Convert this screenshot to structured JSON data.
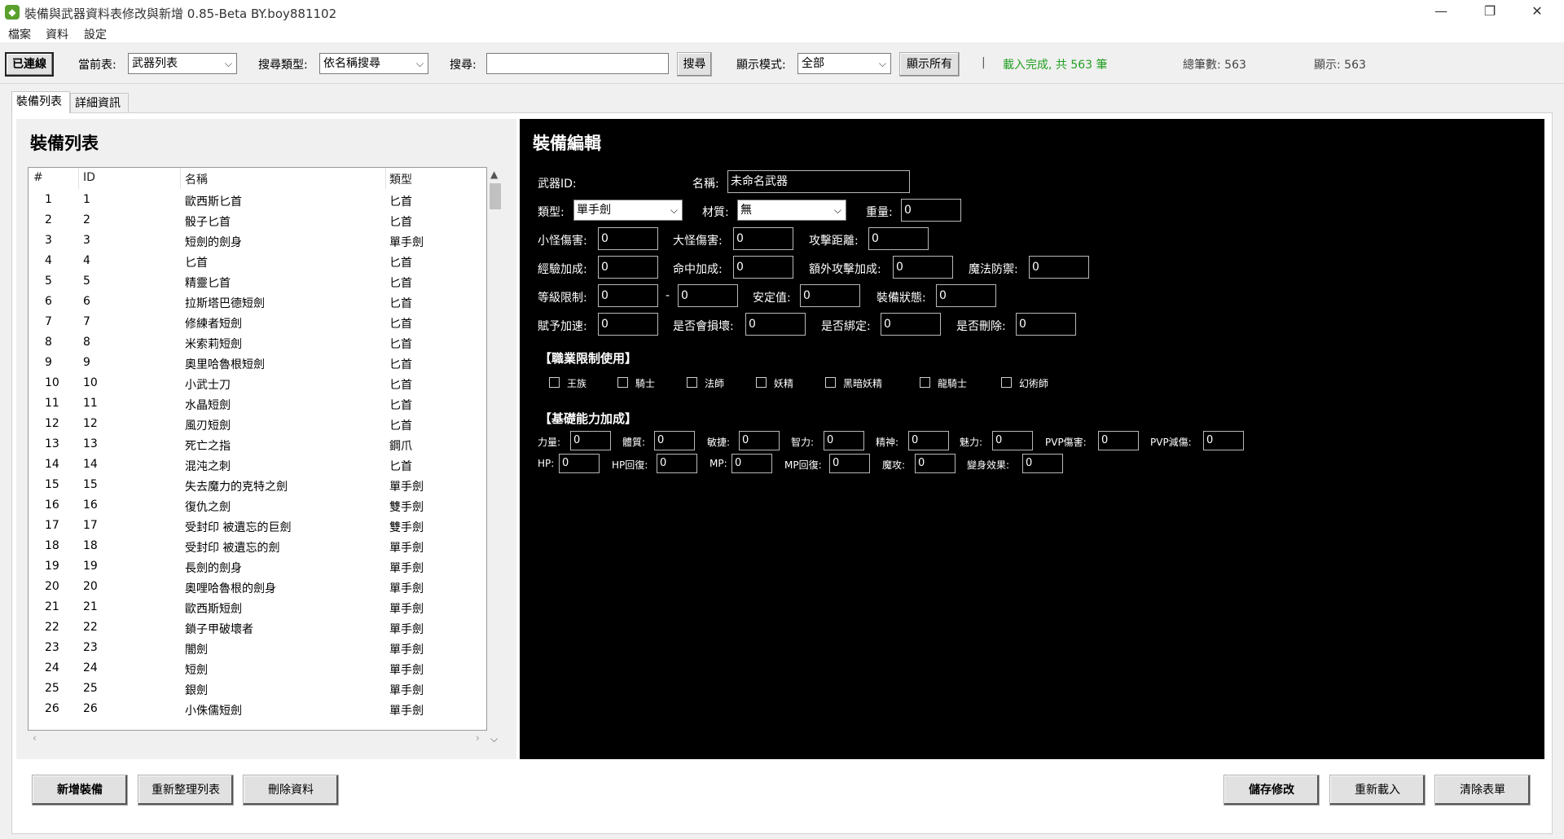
{
  "window": {
    "title": "裝備與武器資料表修改與新增 0.85-Beta BY.boy881102",
    "icon": "app-icon",
    "minimize": "—",
    "maximize": "❐",
    "close": "✕"
  },
  "menu": [
    "檔案",
    "資料",
    "設定"
  ],
  "toolbar": {
    "connect_label": "已連線",
    "current_table_label": "當前表:",
    "current_table_value": "武器列表",
    "search_type_label": "搜尋類型:",
    "search_type_value": "依名稱搜尋",
    "search_label": "搜尋:",
    "search_value": "",
    "search_button": "搜尋",
    "display_mode_label": "顯示模式:",
    "display_mode_value": "全部",
    "show_all_button": "顯示所有",
    "separator": "|",
    "status": "載入完成, 共 563 筆",
    "status_color": "#22a022",
    "total": "總筆數: 563",
    "shown": "顯示: 563"
  },
  "tabs": [
    {
      "label": "裝備列表",
      "active": true
    },
    {
      "label": "詳細資訊",
      "active": false
    }
  ],
  "list": {
    "heading": "裝備列表",
    "columns": [
      "#",
      "ID",
      "名稱",
      "類型"
    ],
    "rows": [
      [
        "1",
        "1",
        "歐西斯匕首",
        "匕首"
      ],
      [
        "2",
        "2",
        "骰子匕首",
        "匕首"
      ],
      [
        "3",
        "3",
        "短劍的劍身",
        "單手劍"
      ],
      [
        "4",
        "4",
        "匕首",
        "匕首"
      ],
      [
        "5",
        "5",
        "精靈匕首",
        "匕首"
      ],
      [
        "6",
        "6",
        "拉斯塔巴德短劍",
        "匕首"
      ],
      [
        "7",
        "7",
        "修練者短劍",
        "匕首"
      ],
      [
        "8",
        "8",
        "米索莉短劍",
        "匕首"
      ],
      [
        "9",
        "9",
        "奧里哈魯根短劍",
        "匕首"
      ],
      [
        "10",
        "10",
        "小武士刀",
        "匕首"
      ],
      [
        "11",
        "11",
        "水晶短劍",
        "匕首"
      ],
      [
        "12",
        "12",
        "風刃短劍",
        "匕首"
      ],
      [
        "13",
        "13",
        "死亡之指",
        "鋼爪"
      ],
      [
        "14",
        "14",
        "混沌之刺",
        "匕首"
      ],
      [
        "15",
        "15",
        "失去魔力的克特之劍",
        "單手劍"
      ],
      [
        "16",
        "16",
        "復仇之劍",
        "雙手劍"
      ],
      [
        "17",
        "17",
        "受封印 被遺忘的巨劍",
        "雙手劍"
      ],
      [
        "18",
        "18",
        "受封印 被遺忘的劍",
        "單手劍"
      ],
      [
        "19",
        "19",
        "長劍的劍身",
        "單手劍"
      ],
      [
        "20",
        "20",
        "奧哩哈魯根的劍身",
        "單手劍"
      ],
      [
        "21",
        "21",
        "歐西斯短劍",
        "單手劍"
      ],
      [
        "22",
        "22",
        "鎖子甲破壞者",
        "單手劍"
      ],
      [
        "23",
        "23",
        "闇劍",
        "單手劍"
      ],
      [
        "24",
        "24",
        "短劍",
        "單手劍"
      ],
      [
        "25",
        "25",
        "銀劍",
        "單手劍"
      ],
      [
        "26",
        "26",
        "小侏儒短劍",
        "單手劍"
      ]
    ]
  },
  "edit": {
    "heading": "裝備編輯",
    "weapon_id_label": "武器ID:",
    "name_label": "名稱:",
    "name_value": "未命名武器",
    "type_label": "類型:",
    "type_value": "單手劍",
    "material_label": "材質:",
    "material_value": "無",
    "weight_label": "重量:",
    "weight_value": "0",
    "small_dmg_label": "小怪傷害:",
    "small_dmg_value": "0",
    "large_dmg_label": "大怪傷害:",
    "large_dmg_value": "0",
    "range_label": "攻擊距離:",
    "range_value": "0",
    "exp_label": "經驗加成:",
    "exp_value": "0",
    "hit_label": "命中加成:",
    "hit_value": "0",
    "extra_atk_label": "額外攻擊加成:",
    "extra_atk_value": "0",
    "mr_label": "魔法防禦:",
    "mr_value": "0",
    "level_label": "等級限制:",
    "level_min": "0",
    "level_dash": "-",
    "level_max": "0",
    "safe_label": "安定值:",
    "safe_value": "0",
    "equip_state_label": "裝備狀態:",
    "equip_state_value": "0",
    "haste_label": "賦予加速:",
    "haste_value": "0",
    "breakable_label": "是否會損壞:",
    "breakable_value": "0",
    "bind_label": "是否綁定:",
    "bind_value": "0",
    "delete_label": "是否刪除:",
    "delete_value": "0",
    "class_section": "【職業限制使用】",
    "classes": [
      "王族",
      "騎士",
      "法師",
      "妖精",
      "黑暗妖精",
      "龍騎士",
      "幻術師"
    ],
    "stat_section": "【基礎能力加成】",
    "stats_row1": [
      {
        "label": "力量:",
        "value": "0"
      },
      {
        "label": "體質:",
        "value": "0"
      },
      {
        "label": "敏捷:",
        "value": "0"
      },
      {
        "label": "智力:",
        "value": "0"
      },
      {
        "label": "精神:",
        "value": "0"
      },
      {
        "label": "魅力:",
        "value": "0"
      },
      {
        "label": "PVP傷害:",
        "value": "0"
      },
      {
        "label": "PVP減傷:",
        "value": "0"
      }
    ],
    "stats_row2": [
      {
        "label": "HP:",
        "value": "0"
      },
      {
        "label": "HP回復:",
        "value": "0"
      },
      {
        "label": "MP:",
        "value": "0"
      },
      {
        "label": "MP回復:",
        "value": "0"
      },
      {
        "label": "魔攻:",
        "value": "0"
      },
      {
        "label": "變身效果:",
        "value": "0"
      }
    ]
  },
  "buttons": {
    "add": "新增裝備",
    "refresh_list": "重新整理列表",
    "delete": "刪除資料",
    "save": "儲存修改",
    "reload": "重新載入",
    "clear": "清除表單"
  }
}
